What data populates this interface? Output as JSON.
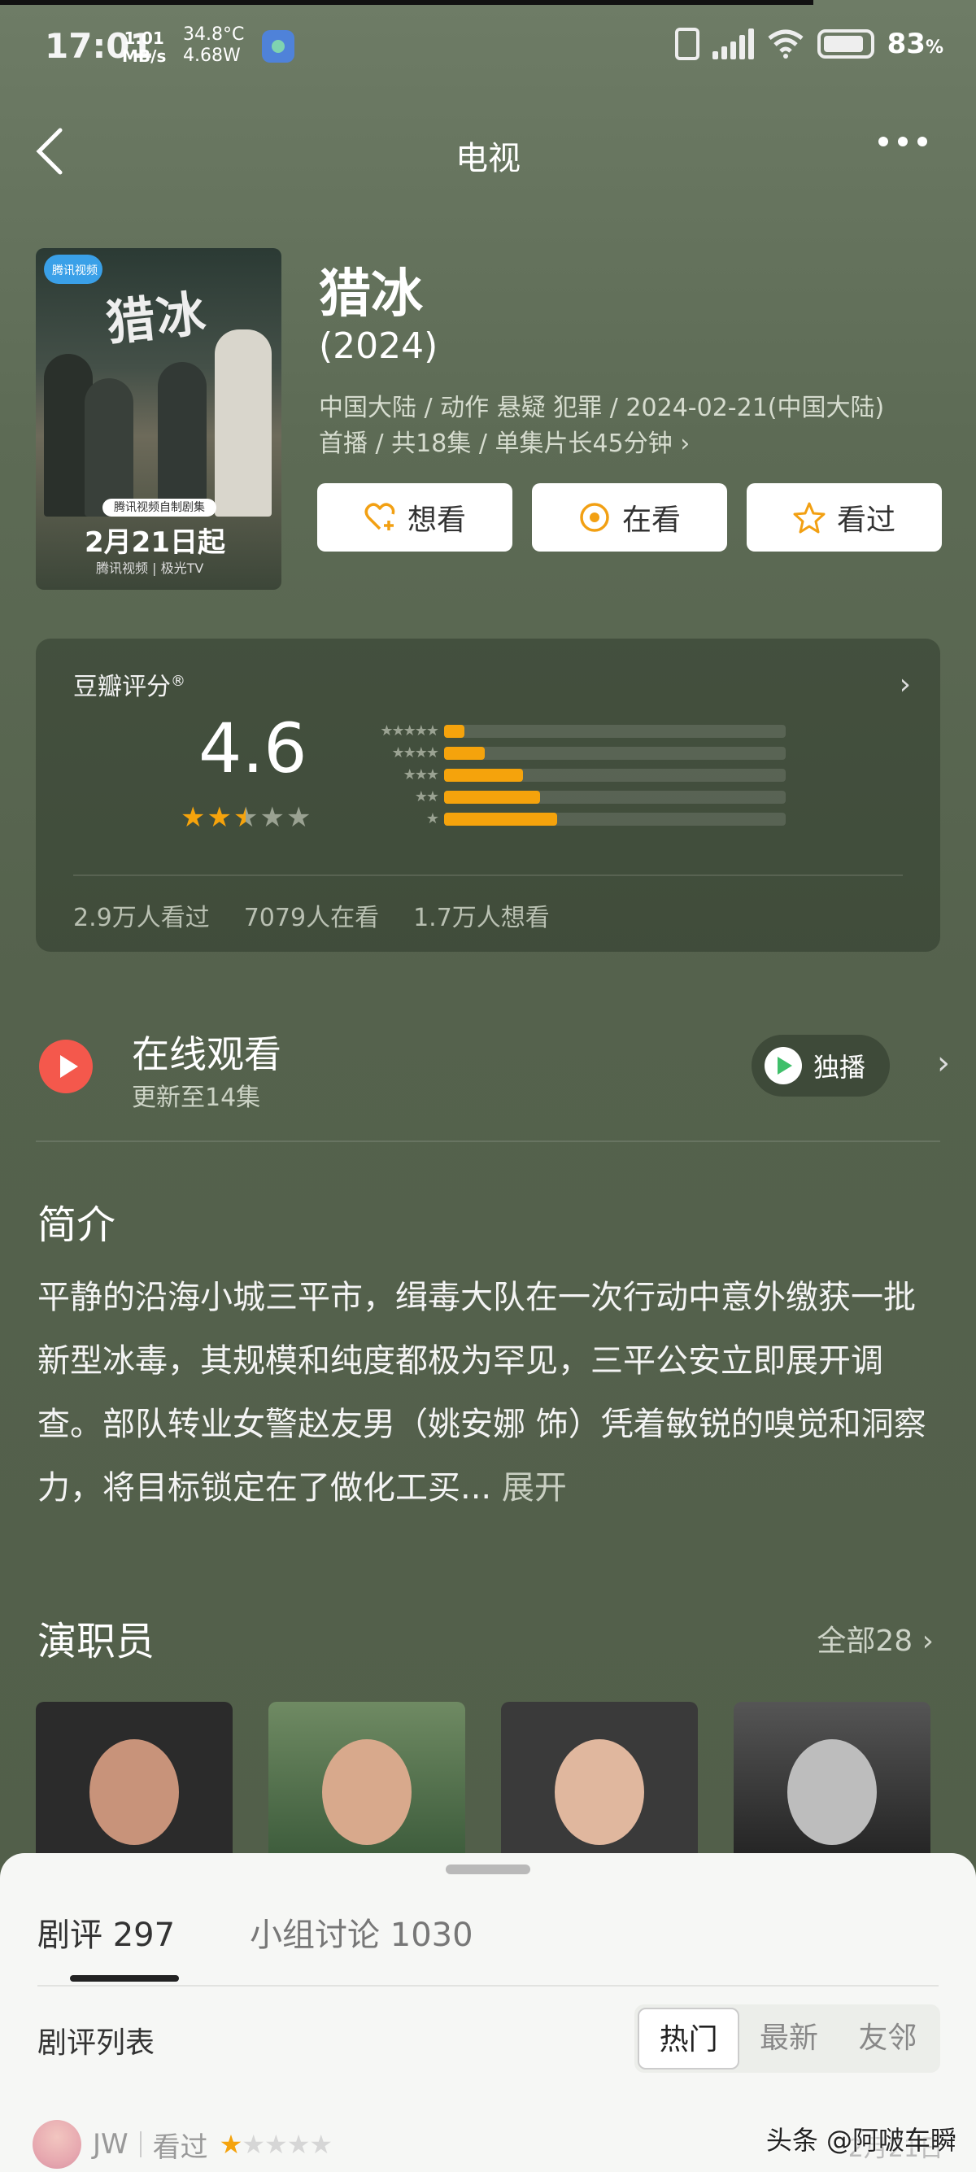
{
  "status_bar": {
    "time": "17:01",
    "speed_value": "1.01",
    "speed_unit": "MB/s",
    "temperature": "34.8°C",
    "power": "4.68W",
    "battery_pct": "83",
    "battery_unit": "%"
  },
  "nav": {
    "title": "电视"
  },
  "poster": {
    "platform_badge": "腾讯视频",
    "title_art": "猎冰",
    "tagline": "腾讯视频自制剧集",
    "date": "2月21日起",
    "platforms": "腾讯视频 | 极光TV"
  },
  "show": {
    "title": "猎冰",
    "year": "(2024)",
    "meta_line1": "中国大陆 / 动作 悬疑 犯罪 / 2024-02-21(中国大陆)",
    "meta_line2": "首播 / 共18集 / 单集片长45分钟 ›"
  },
  "actions": [
    {
      "label": "想看",
      "icon": "heart-plus-icon"
    },
    {
      "label": "在看",
      "icon": "target-icon"
    },
    {
      "label": "看过",
      "icon": "star-icon"
    }
  ],
  "rating": {
    "label": "豆瓣评分",
    "reg_mark": "®",
    "score": "4.6",
    "star_value": 2.5,
    "distribution": [
      {
        "stars": 5,
        "fraction": 0.06
      },
      {
        "stars": 4,
        "fraction": 0.12
      },
      {
        "stars": 3,
        "fraction": 0.23
      },
      {
        "stars": 2,
        "fraction": 0.28
      },
      {
        "stars": 1,
        "fraction": 0.33
      }
    ],
    "watched": "2.9万人看过",
    "watching": "7079人在看",
    "want": "1.7万人想看"
  },
  "watch": {
    "title": "在线观看",
    "subtitle": "更新至14集",
    "exclusive": "独播"
  },
  "intro": {
    "title": "简介",
    "text": "平静的沿海小城三平市，缉毒大队在一次行动中意外缴获一批新型冰毒，其规模和纯度都极为罕见，三平公安立即展开调查。部队转业女警赵友男（姚安娜 饰）凭着敏锐的嗅觉和洞察力，将目标锁定在了做化工买...",
    "more": "展开"
  },
  "cast": {
    "title": "演职员",
    "all": "全部28 ›"
  },
  "sheet": {
    "tabs": [
      {
        "label": "剧评 297"
      },
      {
        "label": "小组讨论 1030"
      }
    ],
    "list_title": "剧评列表",
    "sort": [
      "热门",
      "最新",
      "友邻"
    ],
    "review": {
      "user": "JW",
      "status": "看过",
      "rating": 1,
      "date": "2月21日"
    }
  },
  "watermark": "头条 @阿啵车瞬",
  "colors": {
    "accent": "#f5a30c",
    "play_red": "#f4584c",
    "background": "#5d6b55"
  }
}
